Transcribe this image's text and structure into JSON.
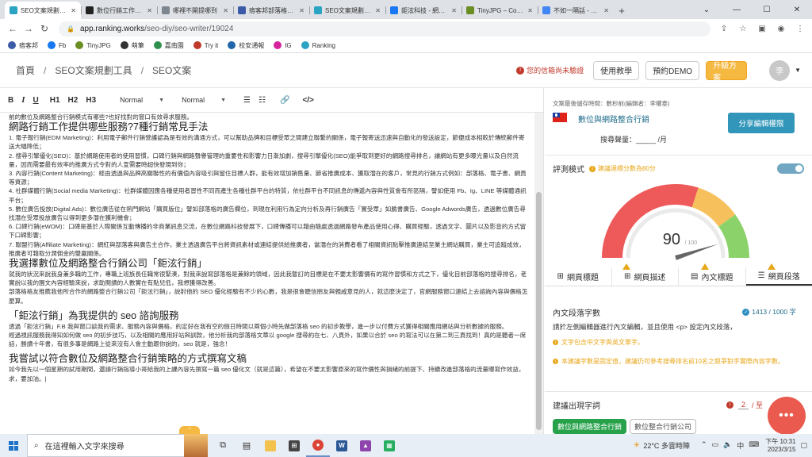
{
  "browser": {
    "tabs": [
      {
        "title": "SEO文案規劃工具",
        "icon": "ranking-favicon",
        "color": "#2ba3c3",
        "active": true
      },
      {
        "title": "數位行銷工作內容",
        "icon": "notion-favicon",
        "color": "#222222",
        "active": false
      },
      {
        "title": "哪裡不開提哪到",
        "icon": "docs-favicon",
        "color": "#7d8690",
        "active": false
      },
      {
        "title": "痞客邦部落格後台",
        "icon": "pixnet-favicon",
        "color": "#3b5ba8",
        "active": false
      },
      {
        "title": "SEO文案規劃工具",
        "icon": "ranking-favicon",
        "color": "#2ba3c3",
        "active": false
      },
      {
        "title": "鉅泫科技 - 網路整合",
        "icon": "facebook-favicon",
        "color": "#1877f2",
        "active": false
      },
      {
        "title": "TinyJPG – Comp",
        "icon": "tinyjpg-favicon",
        "color": "#6b8e23",
        "active": false
      },
      {
        "title": "不如一隔話 - Goo",
        "icon": "google-favicon",
        "color": "#4285f4",
        "active": false
      }
    ],
    "new_tab": "+",
    "url_host": "app.ranking.works",
    "url_path": "/seo-diy/seo-writer/19024",
    "bookmarks": [
      {
        "label": "痞客邦",
        "color": "#3b5ba8"
      },
      {
        "label": "Fb",
        "color": "#1877f2"
      },
      {
        "label": "TinyJPG",
        "color": "#6b8e23"
      },
      {
        "label": "萌筆",
        "color": "#333333"
      },
      {
        "label": "嘉南園",
        "color": "#2f8f4e"
      },
      {
        "label": "Try it",
        "color": "#c0392b"
      },
      {
        "label": "校安通報",
        "color": "#2266aa"
      },
      {
        "label": "IG",
        "color": "#d6249f"
      },
      {
        "label": "Ranking",
        "color": "#2ba3c3"
      }
    ]
  },
  "header": {
    "crumbs": [
      "首頁",
      "SEO文案規劃工具",
      "SEO文案"
    ],
    "credit": "您的信箱尚未驗證",
    "tutorial": "使用教學",
    "demo": "預約DEMO",
    "upgrade": "升級方案",
    "avatar": "李"
  },
  "editor": {
    "toolbar": {
      "bold": "B",
      "italic": "I",
      "underline": "U",
      "h1": "H1",
      "h2": "H2",
      "h3": "H3",
      "style1": "Normal",
      "style2": "Normal",
      "link": "🔗",
      "code": "</>"
    },
    "blocks": [
      {
        "t": "p",
        "text": "前的數位及網路整合行銷模式有哪些?也好找對的窗口有效尋求服務。"
      },
      {
        "t": "h",
        "text": "網路行銷工作提供哪些服務?7種行銷常見手法"
      },
      {
        "t": "p",
        "text": "1. 電子報行銷(EDM Marketing)：利用電子郵件行銷營護認為是有效的溝通方式，可以幫助品牌和目標受眾之間建立聯繫的關係，電子報寄送迅速與自動化的發送設定，節便成本相較於傳統郵件寄送大幅降低；"
      },
      {
        "t": "p",
        "text": "2. 搜尋引擎優化(SEO)：基於網路使用者的使用習慣，口碑行銷與網路聲譽管理的重要性和影響力日漸加劇，搜尋引擎優化(SEO)能爭取到更好的網路搜尋排名，讓網站有更多曝光量以及自然流量，因而需要最有效率的推廣方式令對的人宣需要時超快發現到你；"
      },
      {
        "t": "p",
        "text": "3. 內容行銷(Content Marketing)：經由透過與品牌高關聯性的有價值內容吸引與留住目標人群，能有效增加銷售量、節省推廣成本、獲取潛在的客戶，常見的行銷方式例如：部落格、電子書、網頁等資源；"
      },
      {
        "t": "p",
        "text": "4. 社群媒體行銷(Social media Marketing)：社群媒體因應各種使用者習性不同而產生各種社群平台的特質，依社群平台不同訊息的傳遞內容與性質會有所區隔，譬如使用 Fb、Ig、LINE 等媒體通訊平台；"
      },
      {
        "t": "p",
        "text": "5. 數位廣告投放(Digital Ads)：數位廣告從在熱門網站「購買版位」譬如部落格的廣告欄位，到現在利用行為定向分析及再行銷廣告「實受眾」如臉書廣告、Google Adwords廣告，透過數位廣告尋找潛在受眾投放廣告以得到更多潛在獲利機會；"
      },
      {
        "t": "p",
        "text": "6. 口碑行銷(eWOM)：口碑是基於人際關係互動傳播的非商業訊息交流，在數位網路科技發展下，口碑傳播可以藉由隨處透過網路發布產品使用心得、購買經驗，透過文字、圖片以及影音的方式留下口碑影響；"
      },
      {
        "t": "p",
        "text": "7. 聯盟行銷(Affiliate Marketing)：網紅與部落客與廣告主合作，業主透過廣告平台將資訊素材或連結提供給推廣者，當潛在的消費者看了相關資訊點擊推廣連結至業主網站購買，業主可追蹤成效，推廣者可藉取分潤佣金的雙贏關係。"
      },
      {
        "t": "h",
        "text": "我選擇數位及網路整合行銷公司「鉅泫行銷」"
      },
      {
        "t": "p",
        "text": "就我的狀況來說我身兼多職的工作，專職上班族長任職常很緊湊，對我來說寫部落格是兼餘的領域，因此我暫訂的目標是在不要太影響價有的寫作習慣和方式之下，優化目前部落格的搜尋排名，老實說以我的園文內容經驗來說，求助閱讀的人數實在有點兒低，我想獲得改善。"
      },
      {
        "t": "p",
        "text": "部落格格友推薦我他所合作的網路整合行銷公司「鉅泫行銷」，說射他的 SEO 優化經驗有不少的心數，我是很會聽信朋友與親戚意見的人，就這麼決定了，官網服務窗口連結上去諮詢內容與價格怎麼算。"
      },
      {
        "t": "sp"
      },
      {
        "t": "h",
        "text": "「鉅泫行銷」為我提供的 seo 諮詢服務"
      },
      {
        "t": "p",
        "text": "透過「鉅泫行銷」F.B 我與窗口談我的需求、服務內容與價格，約定好在我有空的假日時間以兩個小時先做部落格 seo 的初步教學，進一步以付費方式獲得相關應用網站與分析數據的服務。"
      },
      {
        "t": "p",
        "text": "經過視訊服務我得知如何做 seo 的初步技巧，以及相關的應用好站與訓款，他分析我的部落格文章以 google 搜尋約在七、八頁外，如果以合於 seo 的寫法可以在第二到三頁找到！真的是聽者一席話，勝讀十年書，有很多事是網路上從來沒有人會主動跟你說的，seo 就是，強念！"
      },
      {
        "t": "sp"
      },
      {
        "t": "h",
        "text": "我嘗試以符合數位及網路整合行銷策略的方式撰寫文稿"
      },
      {
        "t": "p",
        "text": "如今我先以一個星期的試用期間，還請行銷指導小哥給我的上課內容先撰寫一篇 seo 優化文（就是這篇），希望在不要太影響原來的寫作價性與損緒的前提下、持續改進部落格的流量曝寫作效益，求，要加油。|"
      }
    ],
    "expand_arrow": "⌃"
  },
  "panel": {
    "meta": "文案最後儲存時間：數秒前(編輯者：李權泰)",
    "keyword": "數位與網路整合行銷",
    "share_button": "分享編輯權限",
    "search_volume": "搜尋聲量：_____ /月",
    "eval_label": "評測模式",
    "eval_hint": "建議達標分數為80分",
    "eval_toggle_on": true,
    "score": "90",
    "score_max": "/ 100",
    "score_value": 90,
    "gauge_colors": [
      "#ee5a5a",
      "#f6c05c",
      "#8cd26a"
    ],
    "tabs": [
      {
        "label": "網頁標題",
        "icon": "grid-icon",
        "active": false
      },
      {
        "label": "網頁描述",
        "icon": "grid-icon",
        "active": false
      },
      {
        "label": "內文標題",
        "icon": "heading-icon",
        "active": false
      },
      {
        "label": "網頁段落",
        "icon": "paragraph-icon",
        "active": true
      }
    ],
    "section_title": "內文段落字數",
    "section_count": "1413 / 1000 字",
    "section_desc": "請於左側編輯器進行內文編輯，並且使用 <p> 設定內文段落，",
    "tip1": "文字包含中文字與英文單字。",
    "tip2": "本建議字數是固定值，建議仍可參考搜尋排名前10名之競爭對手實際內容字數。",
    "suggest_title": "建議出現字詞",
    "suggest_count": "2",
    "suggest_total": "/ 至",
    "chips": [
      {
        "label": "數位與網路整合行銷",
        "on": true
      },
      {
        "label": "數位整合行銷公司",
        "on": false
      }
    ],
    "fab": "•••"
  },
  "taskbar": {
    "search_placeholder": "在這裡輸入文字來搜尋",
    "weather": "22°C 多雲時陣",
    "lang": "中",
    "time": "下午 10:31",
    "date": "2023/3/15"
  }
}
